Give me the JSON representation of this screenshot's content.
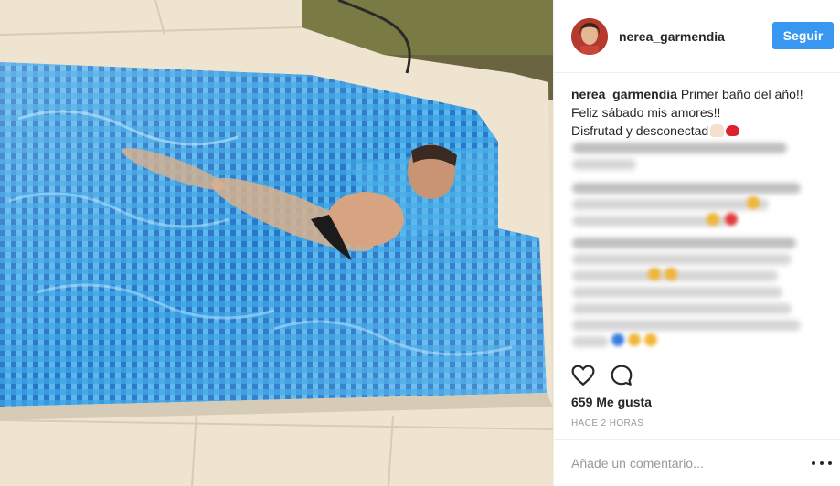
{
  "post": {
    "username": "nerea_garmendia",
    "follow_label": "Seguir",
    "caption": {
      "username": "nerea_garmendia",
      "line1": "Primer baño del año!!",
      "line2": "Feliz sábado mis amores!!",
      "line3": "Disfrutad y desconectad"
    },
    "likes": "659 Me gusta",
    "time": "HACE 2 HORAS",
    "comment_placeholder": "Añade un comentario..."
  },
  "colors": {
    "accent": "#3897f0",
    "pool_water": "#2a8fd8",
    "pool_edge": "#eee3cf"
  },
  "icons": [
    "heart-icon",
    "comment-bubble-icon",
    "more-options-icon",
    "hands-emoji-icon",
    "kiss-lips-emoji-icon"
  ]
}
